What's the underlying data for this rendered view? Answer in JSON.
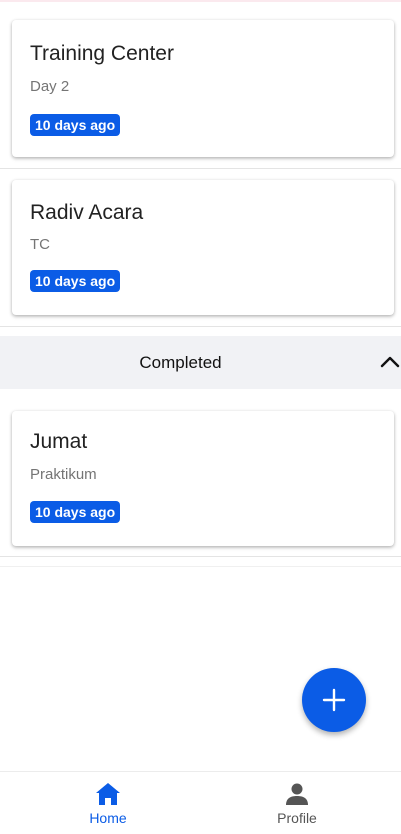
{
  "pending": [
    {
      "title": "Training Center",
      "subtitle": "Day 2",
      "time": "10 days ago"
    },
    {
      "title": "Radiv Acara",
      "subtitle": "TC",
      "time": "10 days ago"
    }
  ],
  "completed_section": {
    "title": "Completed"
  },
  "completed": [
    {
      "title": "Jumat",
      "subtitle": "Praktikum",
      "time": "10 days ago"
    }
  ],
  "fab": {
    "icon": "plus-icon"
  },
  "nav": {
    "home": {
      "label": "Home",
      "icon": "home-icon"
    },
    "profile": {
      "label": "Profile",
      "icon": "person-icon"
    }
  },
  "colors": {
    "accent": "#0b5ce6",
    "section_bg": "#f1f2f5"
  }
}
